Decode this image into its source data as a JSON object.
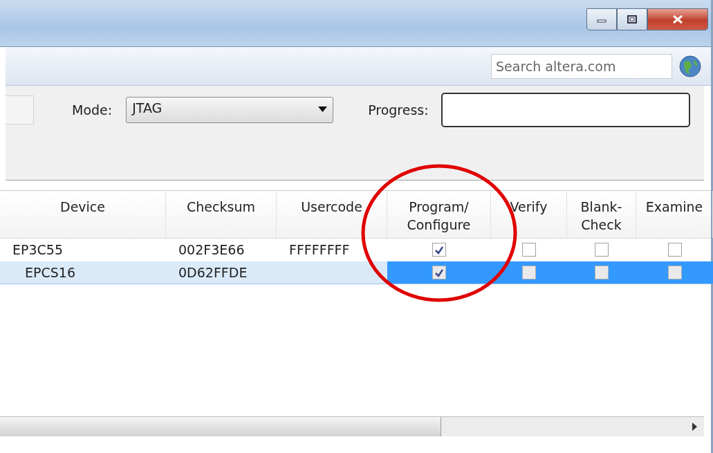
{
  "window": {
    "buttons": [
      {
        "kind": "minimize"
      },
      {
        "kind": "maximize"
      },
      {
        "kind": "close"
      }
    ]
  },
  "toolbar": {
    "search": {
      "placeholder": "Search altera.com"
    }
  },
  "settings": {
    "mode_label": "Mode:",
    "mode_value": "JTAG",
    "progress_label": "Progress:"
  },
  "table": {
    "columns": [
      "Device",
      "Checksum",
      "Usercode",
      "Program/\nConfigure",
      "Verify",
      "Blank-\nCheck",
      "Examine"
    ],
    "rows": [
      {
        "cells": [
          "EP3C55",
          "002F3E66",
          "FFFFFFFF"
        ],
        "selected": false,
        "checks": [
          {
            "checked": true
          },
          {
            "checked": false
          },
          {
            "checked": false
          },
          {
            "checked": false
          }
        ],
        "children": [
          {
            "cells": [
              "EPCS16",
              "0D62FFDE"
            ],
            "selected": true,
            "checks": [
              {
                "checked": true
              },
              {
                "checked": false
              },
              {
                "checked": false
              },
              {
                "checked": false
              }
            ]
          }
        ]
      }
    ]
  },
  "annotation": {
    "kind": "circle"
  }
}
